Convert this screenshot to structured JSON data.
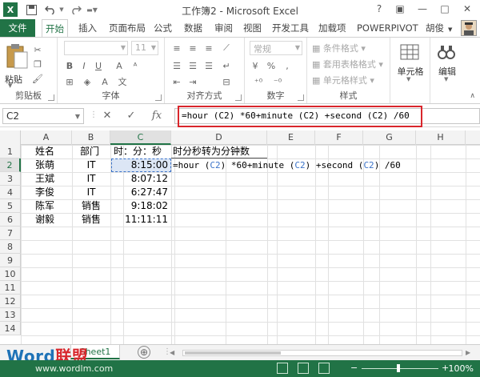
{
  "window": {
    "title": "工作簿2 - Microsoft Excel",
    "app_icon": "X"
  },
  "quick_access": [
    "save-icon",
    "undo-icon",
    "redo-icon",
    "customize-icon"
  ],
  "window_buttons": {
    "help": "?",
    "restore_ribbon": "▣",
    "minimize": "—",
    "maximize": "□",
    "close": "✕"
  },
  "tabs": [
    "文件",
    "开始",
    "插入",
    "页面布局",
    "公式",
    "数据",
    "审阅",
    "视图",
    "开发工具",
    "加载项",
    "POWERPIVOT"
  ],
  "user": "胡俊",
  "ribbon": {
    "clipboard": {
      "paste": "粘贴",
      "label": "剪贴板"
    },
    "font": {
      "name_placeholder": "",
      "size": "11",
      "label": "字体",
      "bold": "B",
      "italic": "I",
      "underline": "U",
      "grow": "A",
      "color_label": "文"
    },
    "alignment": {
      "label": "对齐方式"
    },
    "number": {
      "format": "常规",
      "label": "数字",
      "percent": "%",
      "comma": ","
    },
    "styles": {
      "conditional": "条件格式",
      "table": "套用表格格式",
      "cell": "单元格样式",
      "label": "样式"
    },
    "cells": {
      "label": "单元格"
    },
    "editing": {
      "label": "编辑"
    }
  },
  "formula_bar": {
    "name_box": "C2",
    "cancel": "✕",
    "enter": "✓",
    "fx": "fx",
    "formula": "=hour (C2) *60+minute (C2) +second (C2) /60"
  },
  "grid": {
    "columns": [
      "A",
      "B",
      "C",
      "D",
      "E",
      "F",
      "G",
      "H"
    ],
    "active_column": "C",
    "rows": [
      "1",
      "2",
      "3",
      "4",
      "5",
      "6",
      "7",
      "8",
      "9",
      "10",
      "11",
      "12",
      "13",
      "14"
    ],
    "active_row": "2",
    "cells": {
      "A1": "姓名",
      "B1": "部门",
      "C1": "时：分：秒",
      "D1": "时分秒转为分钟数",
      "A2": "张萌",
      "B2": "IT",
      "C2": "8:15:00",
      "A3": "王斌",
      "B3": "IT",
      "C3": "8:07:12",
      "A4": "李俊",
      "B4": "IT",
      "C4": "6:27:47",
      "A5": "陈军",
      "B5": "销售",
      "C5": "9:18:02",
      "A6": "谢毅",
      "B6": "销售",
      "C6": "11:11:11"
    },
    "d2_formula": {
      "part1": "=hour (",
      "ref1": "C2",
      "part2": ") *60+minute (",
      "ref2": "C2",
      "part3": ") +second (",
      "ref3": "C2",
      "part4": ") /60"
    }
  },
  "sheets": {
    "active": "Sheet1",
    "add": "⊕"
  },
  "watermark": {
    "word": "Word",
    "union": "联盟"
  },
  "status": {
    "url": "www.wordlm.com",
    "zoom": "100%"
  }
}
